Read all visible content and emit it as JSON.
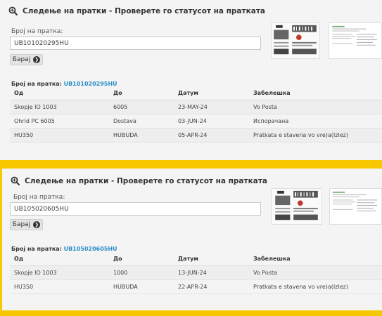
{
  "colors": {
    "background": "#f7c800",
    "panel": "#f4f4f4",
    "link": "#2a8fc7"
  },
  "panels": [
    {
      "title": "Следење на пратки - Проверете го статусот на пратката",
      "input_label": "Број на пратка:",
      "input_value": "UB101020295HU",
      "button_label": "Барај",
      "result_label": "Број на пратка:",
      "result_number": "UB101020295HU",
      "columns": [
        "Од",
        "До",
        "Датум",
        "Забелешка"
      ],
      "rows": [
        [
          "Skopje IO 1003",
          "6005",
          "23-MAY-24",
          "Vo Posta"
        ],
        [
          "Ohrid PC 6005",
          "Dostava",
          "03-JUN-24",
          "Испорачана"
        ],
        [
          "HU350",
          "HUBUDA",
          "05-APR-24",
          "Pratkata e stavena vo vre)a(Izlez)"
        ]
      ]
    },
    {
      "title": "Следење на пратки - Проверете го статусот на пратката",
      "input_label": "Број на пратка:",
      "input_value": "UB105020605HU",
      "button_label": "Барај",
      "result_label": "Број на пратка:",
      "result_number": "UB105020605HU",
      "columns": [
        "Од",
        "До",
        "Датум",
        "Забелешка"
      ],
      "rows": [
        [
          "Skopje IO 1003",
          "1000",
          "13-JUN-24",
          "Vo Posta"
        ],
        [
          "HU350",
          "HUBUDA",
          "22-APR-24",
          "Pratkata e stavena vo vre)a(Izlez)"
        ]
      ]
    }
  ]
}
